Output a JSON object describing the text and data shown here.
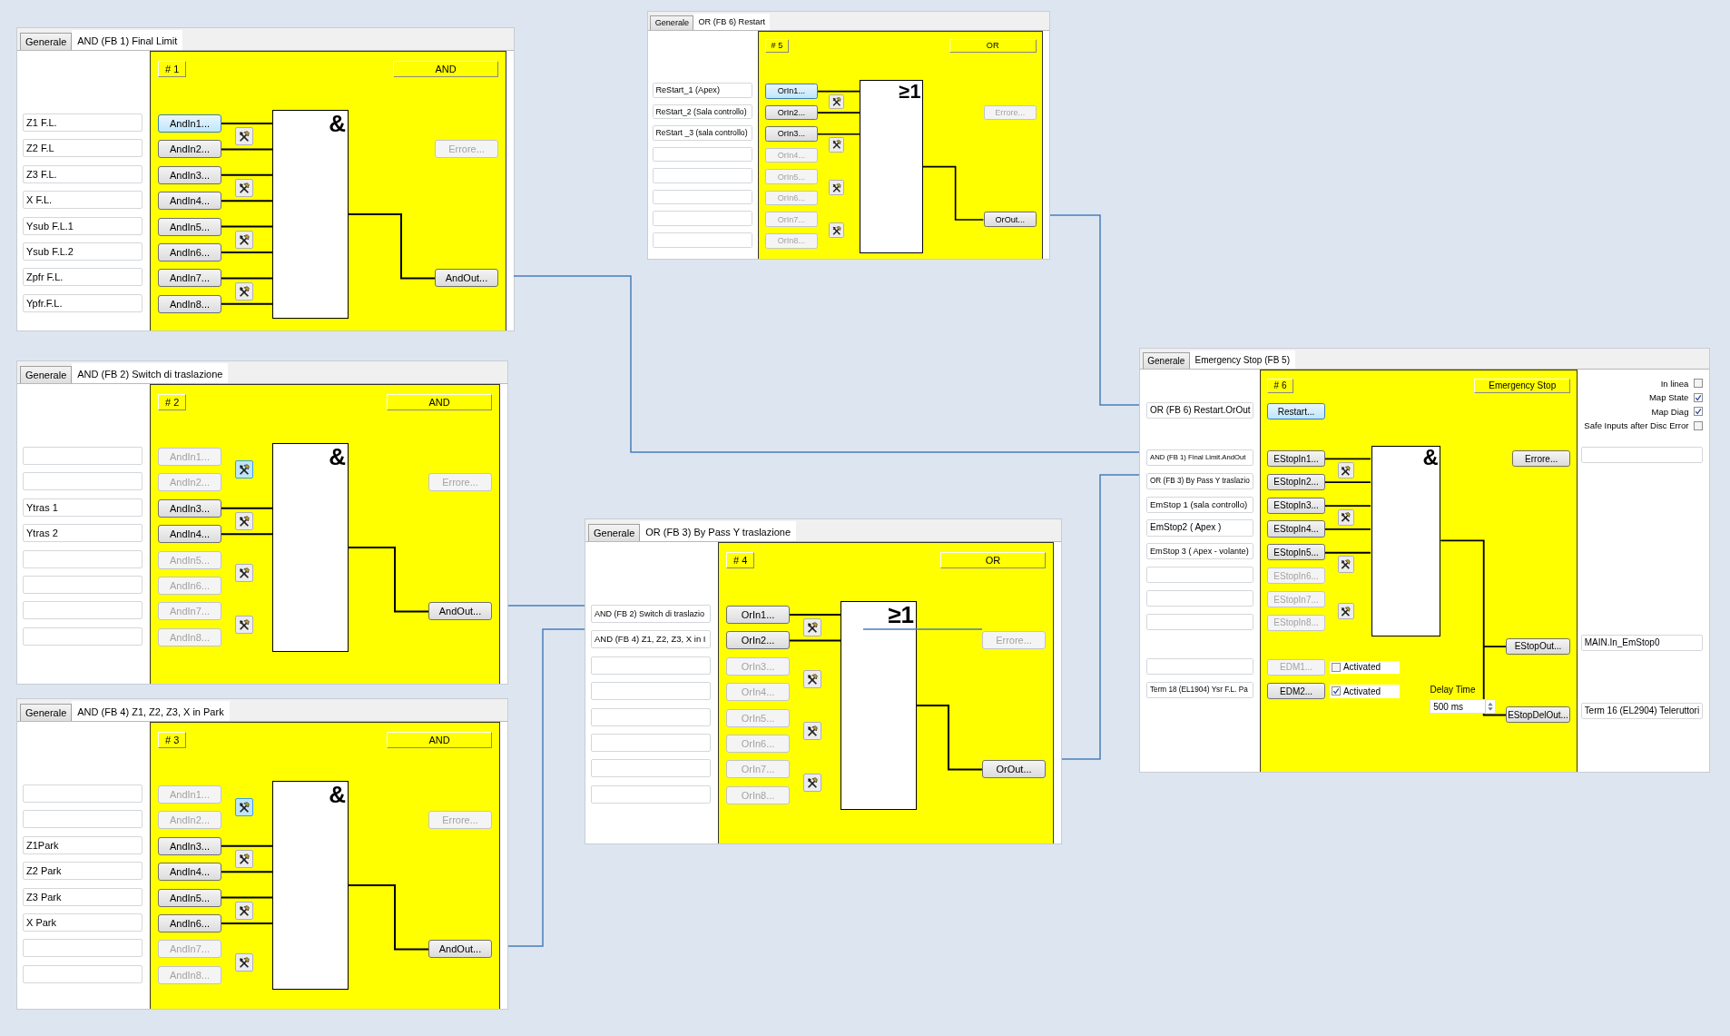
{
  "panels": [
    {
      "kind": "gate",
      "tabs": [
        {
          "label": "Generale",
          "selected": false
        },
        {
          "label": "AND (FB 1) Final Limit",
          "selected": true
        }
      ],
      "number": "# 1",
      "type": "AND",
      "gate_symbol": "&",
      "inputs": [
        {
          "label": "AndIn1...",
          "source": "Z1 F.L.",
          "disabled": false,
          "selected": true
        },
        {
          "label": "AndIn2...",
          "source": "Z2 F.L",
          "disabled": false,
          "selected": false
        },
        {
          "label": "AndIn3...",
          "source": "Z3 F.L.",
          "disabled": false,
          "selected": false
        },
        {
          "label": "AndIn4...",
          "source": "X F.L.",
          "disabled": false,
          "selected": false
        },
        {
          "label": "AndIn5...",
          "source": "Ysub F.L.1",
          "disabled": false,
          "selected": false
        },
        {
          "label": "AndIn6...",
          "source": "Ysub F.L.2",
          "disabled": false,
          "selected": false
        },
        {
          "label": "AndIn7...",
          "source": "Zpfr F.L.",
          "disabled": false,
          "selected": false
        },
        {
          "label": "AndIn8...",
          "source": "Ypfr.F.L.",
          "disabled": false,
          "selected": false
        }
      ],
      "tool_buttons": [
        {
          "selected": false
        },
        {
          "selected": false
        },
        {
          "selected": false
        },
        {
          "selected": false
        }
      ],
      "error_button": {
        "label": "Errore...",
        "disabled": true
      },
      "output": {
        "label": "AndOut...",
        "disabled": false
      }
    },
    {
      "kind": "gate",
      "tabs": [
        {
          "label": "Generale",
          "selected": false
        },
        {
          "label": "OR (FB 6) Restart",
          "selected": true
        }
      ],
      "number": "# 5",
      "type": "OR",
      "gate_symbol": "≥1",
      "inputs": [
        {
          "label": "OrIn1...",
          "source": "ReStart_1 (Apex)",
          "disabled": false,
          "selected": true
        },
        {
          "label": "OrIn2...",
          "source": "ReStart_2 (Sala controllo)",
          "disabled": false,
          "selected": false
        },
        {
          "label": "OrIn3...",
          "source": "ReStart _3 (sala controllo)",
          "disabled": false,
          "selected": false
        },
        {
          "label": "OrIn4...",
          "disabled": true,
          "selected": false
        },
        {
          "label": "OrIn5...",
          "disabled": true,
          "selected": false
        },
        {
          "label": "OrIn6...",
          "disabled": true,
          "selected": false
        },
        {
          "label": "OrIn7...",
          "disabled": true,
          "selected": false
        },
        {
          "label": "OrIn8...",
          "disabled": true,
          "selected": false
        }
      ],
      "tool_buttons": [
        {
          "selected": false
        },
        {
          "selected": false
        },
        {
          "selected": false
        },
        {
          "selected": false
        }
      ],
      "error_button": {
        "label": "Errore...",
        "disabled": true
      },
      "output": {
        "label": "OrOut...",
        "disabled": false
      }
    },
    {
      "kind": "gate",
      "tabs": [
        {
          "label": "Generale",
          "selected": false
        },
        {
          "label": "AND (FB 2) Switch di traslazione",
          "selected": true
        }
      ],
      "number": "# 2",
      "type": "AND",
      "gate_symbol": "&",
      "inputs": [
        {
          "label": "AndIn1...",
          "disabled": true,
          "selected": false
        },
        {
          "label": "AndIn2...",
          "disabled": true,
          "selected": false
        },
        {
          "label": "AndIn3...",
          "source": "Ytras 1",
          "disabled": false,
          "selected": false
        },
        {
          "label": "AndIn4...",
          "source": "Ytras 2",
          "disabled": false,
          "selected": false
        },
        {
          "label": "AndIn5...",
          "disabled": true,
          "selected": false
        },
        {
          "label": "AndIn6...",
          "disabled": true,
          "selected": false
        },
        {
          "label": "AndIn7...",
          "disabled": true,
          "selected": false
        },
        {
          "label": "AndIn8...",
          "disabled": true,
          "selected": false
        }
      ],
      "tool_buttons": [
        {
          "selected": true
        },
        {
          "selected": false
        },
        {
          "selected": false
        },
        {
          "selected": false
        }
      ],
      "error_button": {
        "label": "Errore...",
        "disabled": true
      },
      "output": {
        "label": "AndOut...",
        "disabled": false
      }
    },
    {
      "kind": "emergency_stop",
      "tabs": [
        {
          "label": "Generale",
          "selected": false
        },
        {
          "label": "Emergency Stop (FB 5)",
          "selected": true
        }
      ],
      "number": "# 6",
      "type": "Emergency Stop",
      "gate_symbol": "&",
      "options": [
        {
          "label": "In linea",
          "checked": false
        },
        {
          "label": "Map State",
          "checked": true
        },
        {
          "label": "Map Diag",
          "checked": true
        },
        {
          "label": "Safe Inputs after Disc Error",
          "checked": false
        }
      ],
      "restart": {
        "label": "Restart...",
        "source": "OR (FB 6) Restart.OrOut",
        "selected": true
      },
      "inputs": [
        {
          "label": "EStopIn1...",
          "source": "AND (FB 1) Final Limit.AndOut",
          "disabled": false,
          "selected": false
        },
        {
          "label": "EStopIn2...",
          "source": "OR (FB 3) By Pass Y traslazio",
          "disabled": false,
          "selected": false
        },
        {
          "label": "EStopIn3...",
          "source": "EmStop 1 (sala controllo)",
          "disabled": false,
          "selected": false
        },
        {
          "label": "EStopIn4...",
          "source": "EmStop2 ( Apex )",
          "disabled": false,
          "selected": false
        },
        {
          "label": "EStopIn5...",
          "source": "EmStop 3 ( Apex - volante)",
          "disabled": false,
          "selected": false
        },
        {
          "label": "EStopIn6...",
          "disabled": true,
          "selected": false
        },
        {
          "label": "EStopIn7...",
          "disabled": true,
          "selected": false
        },
        {
          "label": "EStopIn8...",
          "disabled": true,
          "selected": false
        }
      ],
      "tool_buttons": [
        {
          "selected": false
        },
        {
          "selected": false
        },
        {
          "selected": false
        },
        {
          "selected": false
        }
      ],
      "error_button": {
        "label": "Errore...",
        "disabled": false
      },
      "outputs": [
        {
          "label": "EStopOut...",
          "target": "MAIN.In_EmStop0"
        },
        {
          "label": "EStopDelOut...",
          "target": "Term 16 (EL2904) Teleruttori"
        }
      ],
      "edm": [
        {
          "label": "EDM1...",
          "disabled": true,
          "activated": false,
          "activated_label": "Activated"
        },
        {
          "label": "EDM2...",
          "disabled": false,
          "activated": true,
          "activated_label": "Activated",
          "source": "Term 18 (EL1904) Ysr F.L. Pa"
        }
      ],
      "delay": {
        "label": "Delay Time",
        "value": "500 ms"
      }
    },
    {
      "kind": "gate",
      "tabs": [
        {
          "label": "Generale",
          "selected": false
        },
        {
          "label": "OR (FB 3) By Pass Y traslazione",
          "selected": true
        }
      ],
      "number": "# 4",
      "type": "OR",
      "gate_symbol": "≥1",
      "inputs": [
        {
          "label": "OrIn1...",
          "source": "AND (FB 2) Switch di traslazio",
          "disabled": false,
          "selected": false
        },
        {
          "label": "OrIn2...",
          "source": "AND (FB 4) Z1, Z2, Z3, X in I",
          "disabled": false,
          "selected": false
        },
        {
          "label": "OrIn3...",
          "disabled": true,
          "selected": false
        },
        {
          "label": "OrIn4...",
          "disabled": true,
          "selected": false
        },
        {
          "label": "OrIn5...",
          "disabled": true,
          "selected": false
        },
        {
          "label": "OrIn6...",
          "disabled": true,
          "selected": false
        },
        {
          "label": "OrIn7...",
          "disabled": true,
          "selected": false
        },
        {
          "label": "OrIn8...",
          "disabled": true,
          "selected": false
        }
      ],
      "tool_buttons": [
        {
          "selected": false
        },
        {
          "selected": false
        },
        {
          "selected": false
        },
        {
          "selected": false
        }
      ],
      "error_button": {
        "label": "Errore...",
        "disabled": true
      },
      "output": {
        "label": "OrOut...",
        "disabled": false
      }
    },
    {
      "kind": "gate",
      "tabs": [
        {
          "label": "Generale",
          "selected": false
        },
        {
          "label": "AND (FB 4) Z1, Z2, Z3, X  in Park",
          "selected": true
        }
      ],
      "number": "# 3",
      "type": "AND",
      "gate_symbol": "&",
      "inputs": [
        {
          "label": "AndIn1...",
          "disabled": true,
          "selected": false
        },
        {
          "label": "AndIn2...",
          "disabled": true,
          "selected": false
        },
        {
          "label": "AndIn3...",
          "source": "Z1Park",
          "disabled": false,
          "selected": false
        },
        {
          "label": "AndIn4...",
          "source": "Z2 Park",
          "disabled": false,
          "selected": false
        },
        {
          "label": "AndIn5...",
          "source": "Z3 Park",
          "disabled": false,
          "selected": false
        },
        {
          "label": "AndIn6...",
          "source": "X Park",
          "disabled": false,
          "selected": false
        },
        {
          "label": "AndIn7...",
          "disabled": true,
          "selected": false
        },
        {
          "label": "AndIn8...",
          "disabled": true,
          "selected": false
        }
      ],
      "tool_buttons": [
        {
          "selected": true
        },
        {
          "selected": false
        },
        {
          "selected": false
        },
        {
          "selected": false
        }
      ],
      "error_button": {
        "label": "Errore...",
        "disabled": true
      },
      "output": {
        "label": "AndOut...",
        "disabled": false
      }
    }
  ]
}
